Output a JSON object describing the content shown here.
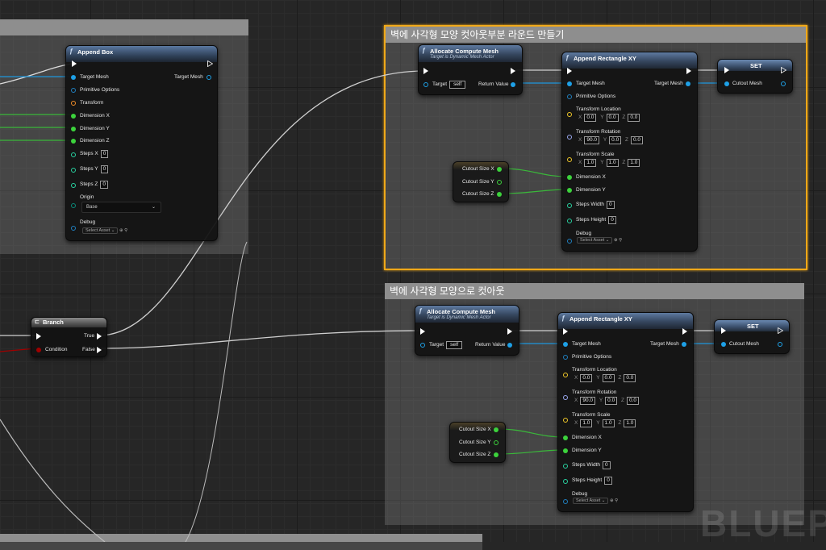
{
  "comments": {
    "top_left_title": "",
    "top_right_title": "벽에 사각형 모양 컷아웃부분 라운드 만들기",
    "bottom_right_title": "벽에 사각형 모양으로 컷아웃"
  },
  "append_box": {
    "title": "Append Box",
    "target_mesh_in": "Target Mesh",
    "primitive_options": "Primitive Options",
    "transform": "Transform",
    "dimension_x": "Dimension X",
    "dimension_y": "Dimension Y",
    "dimension_z": "Dimension Z",
    "steps_x": "Steps X",
    "steps_x_val": "0",
    "steps_y": "Steps Y",
    "steps_y_val": "0",
    "steps_z": "Steps Z",
    "steps_z_val": "0",
    "origin": "Origin",
    "origin_val": "Base",
    "debug": "Debug",
    "select_asset": "Select Asset",
    "target_mesh_out": "Target Mesh"
  },
  "branch": {
    "title": "Branch",
    "condition": "Condition",
    "true_label": "True",
    "false_label": "False"
  },
  "allocate_top": {
    "title": "Allocate Compute Mesh",
    "subtitle": "Target is Dynamic Mesh Actor",
    "target": "Target",
    "target_val": "self",
    "return_value": "Return Value"
  },
  "append_rect_top": {
    "title": "Append Rectangle XY",
    "target_mesh_in": "Target Mesh",
    "target_mesh_out": "Target Mesh",
    "primitive_options": "Primitive Options",
    "transform_location": "Transform Location",
    "loc_x": "0.0",
    "loc_y": "0.0",
    "loc_z": "0.0",
    "transform_rotation": "Transform Rotation",
    "rot_x": "90.0",
    "rot_y": "0.0",
    "rot_z": "0.0",
    "transform_scale": "Transform Scale",
    "scale_x": "1.0",
    "scale_y": "1.0",
    "scale_z": "1.0",
    "dimension_x": "Dimension X",
    "dimension_y": "Dimension Y",
    "steps_width": "Steps Width",
    "steps_width_val": "0",
    "steps_height": "Steps Height",
    "steps_height_val": "0",
    "debug": "Debug",
    "select_asset": "Select Asset"
  },
  "set_top": {
    "title": "SET",
    "cutout_mesh": "Cutout Mesh"
  },
  "cutout_top": {
    "size_x": "Cutout Size X",
    "size_y": "Cutout Size Y",
    "size_z": "Cutout Size Z"
  },
  "allocate_bottom": {
    "title": "Allocate Compute Mesh",
    "subtitle": "Target is Dynamic Mesh Actor",
    "target": "Target",
    "target_val": "self",
    "return_value": "Return Value"
  },
  "append_rect_bottom": {
    "title": "Append Rectangle XY",
    "target_mesh_in": "Target Mesh",
    "target_mesh_out": "Target Mesh",
    "primitive_options": "Primitive Options",
    "transform_location": "Transform Location",
    "loc_x": "0.0",
    "loc_y": "0.0",
    "loc_z": "0.0",
    "transform_rotation": "Transform Rotation",
    "rot_x": "90.0",
    "rot_y": "0.0",
    "rot_z": "0.0",
    "transform_scale": "Transform Scale",
    "scale_x": "1.0",
    "scale_y": "1.0",
    "scale_z": "1.0",
    "dimension_x": "Dimension X",
    "dimension_y": "Dimension Y",
    "steps_width": "Steps Width",
    "steps_width_val": "0",
    "steps_height": "Steps Height",
    "steps_height_val": "0",
    "debug": "Debug",
    "select_asset": "Select Asset"
  },
  "set_bottom": {
    "title": "SET",
    "cutout_mesh": "Cutout Mesh"
  },
  "cutout_bottom": {
    "size_x": "Cutout Size X",
    "size_y": "Cutout Size Y",
    "size_z": "Cutout Size Z"
  },
  "axis": {
    "x": "X",
    "y": "Y",
    "z": "Z"
  },
  "watermark": "BLUEPR",
  "colors": {
    "mesh_pin": "#1ea0e6",
    "float_pin": "#3cd23c",
    "transform_pin": "#f08c28",
    "vector_pin": "#f0c828",
    "rotator_pin": "#9aa8f0",
    "int_pin": "#28d2a0",
    "bool_pin": "#a00000",
    "struct_pin": "#2080c0",
    "selection": "#f0a818"
  }
}
